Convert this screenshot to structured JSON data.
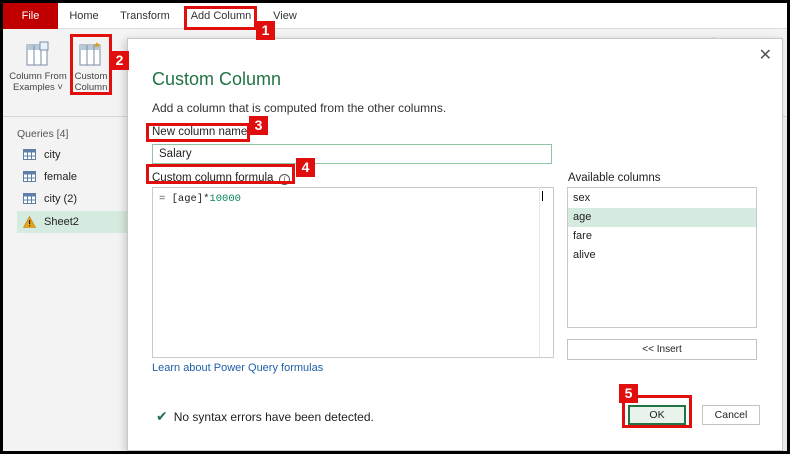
{
  "tabs": {
    "file": "File",
    "home": "Home",
    "transform": "Transform",
    "add_column": "Add Column",
    "view": "View"
  },
  "ribbon": {
    "column_from_examples_line1": "Column From",
    "column_from_examples_line2": "Examples",
    "custom_column_line1": "Custom",
    "custom_column_line2": "Column"
  },
  "queries": {
    "header": "Queries [4]",
    "items": [
      {
        "label": "city",
        "icon": "table-icon"
      },
      {
        "label": "female",
        "icon": "table-icon"
      },
      {
        "label": "city (2)",
        "icon": "table-icon"
      },
      {
        "label": "Sheet2",
        "icon": "warning-icon",
        "selected": true
      }
    ]
  },
  "dialog": {
    "title": "Custom Column",
    "description": "Add a column that is computed from the other columns.",
    "new_column_label": "New column name",
    "new_column_value": "Salary",
    "formula_label": "Custom column formula",
    "formula_prefix": "= ",
    "formula_ref": "[age]*",
    "formula_num": "10000",
    "available_label": "Available columns",
    "available_columns": [
      {
        "label": "sex"
      },
      {
        "label": "age",
        "selected": true
      },
      {
        "label": "fare"
      },
      {
        "label": "alive"
      }
    ],
    "insert_label": "<< Insert",
    "learn_link": "Learn about Power Query formulas",
    "status": "No syntax errors have been detected.",
    "ok_label": "OK",
    "cancel_label": "Cancel"
  },
  "annotations": {
    "badge_1": "1",
    "badge_2": "2",
    "badge_3": "3",
    "badge_4": "4",
    "badge_5": "5",
    "color": "#e10e0e"
  },
  "colors": {
    "accent": "#217346",
    "file_tab": "#c00000",
    "selection": "#d6ebdf"
  }
}
